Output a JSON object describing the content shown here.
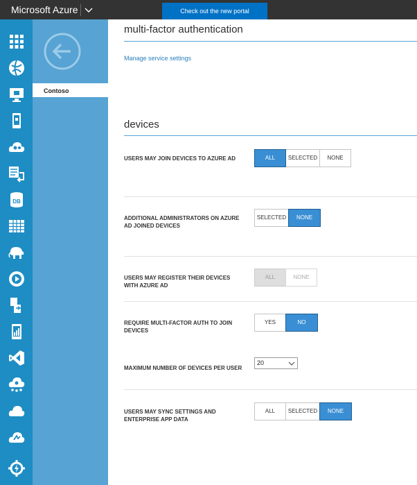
{
  "topbar": {
    "brand": "Microsoft Azure",
    "portal_button": "Check out the new portal"
  },
  "rail": {
    "icons": [
      "all-items-icon",
      "web-apps-icon",
      "virtual-machines-icon",
      "mobile-services-icon",
      "cloud-services-icon",
      "batch-services-icon",
      "sql-databases-icon",
      "storage-icon",
      "hdinsight-icon",
      "media-services-icon",
      "service-bus-icon",
      "mobile-engagement-icon",
      "visual-studio-online-icon",
      "cache-icon",
      "biztalk-services-icon",
      "recovery-services-icon",
      "scheduler-icon"
    ]
  },
  "subnav": {
    "directory": "Contoso"
  },
  "mfa": {
    "title": "multi-factor authentication",
    "manage_link": "Manage service settings"
  },
  "devices": {
    "title": "devices",
    "settings": [
      {
        "label": "USERS MAY JOIN DEVICES TO AZURE AD",
        "options": [
          "ALL",
          "SELECTED",
          "NONE"
        ],
        "selected": "ALL",
        "enabled": true
      },
      {
        "label": "ADDITIONAL ADMINISTRATORS ON AZURE AD JOINED DEVICES",
        "options": [
          "SELECTED",
          "NONE"
        ],
        "selected": "NONE",
        "enabled": true
      },
      {
        "label": "USERS MAY REGISTER THEIR DEVICES WITH AZURE AD",
        "options": [
          "ALL",
          "NONE"
        ],
        "selected": "ALL",
        "enabled": false
      },
      {
        "label": "REQUIRE MULTI-FACTOR AUTH TO JOIN DEVICES",
        "options": [
          "YES",
          "NO"
        ],
        "selected": "NO",
        "enabled": true
      },
      {
        "label": "MAXIMUM NUMBER OF DEVICES PER USER",
        "value": "20"
      },
      {
        "label": "USERS MAY SYNC SETTINGS AND ENTERPRISE APP DATA",
        "options": [
          "ALL",
          "SELECTED",
          "NONE"
        ],
        "selected": "NONE",
        "enabled": true
      }
    ]
  },
  "colors": {
    "topbar": "#333333",
    "rail": "#1e8dc4",
    "subnav": "#56a3d4",
    "accent": "#3a8fd4",
    "portal_button": "#0072c6"
  }
}
